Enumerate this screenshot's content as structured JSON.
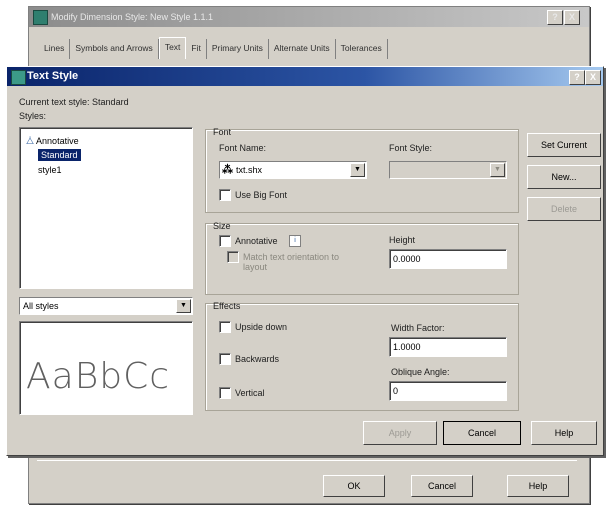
{
  "background_dialog": {
    "title": "Modify Dimension Style: New Style 1.1.1",
    "help_btn": "?",
    "close_btn": "X",
    "tabs": [
      "Lines",
      "Symbols and Arrows",
      "Text",
      "Fit",
      "Primary Units",
      "Alternate Units",
      "Tolerances"
    ],
    "ok_label": "OK",
    "cancel_label": "Cancel",
    "help_label": "Help"
  },
  "dialog": {
    "title": "Text Style",
    "help_btn": "?",
    "close_btn": "X",
    "current_style_label": "Current text style:",
    "current_style_value": "Standard",
    "styles_label": "Styles:",
    "styles": [
      "Annotative",
      "Standard",
      "style1"
    ],
    "styles_filter": "All styles",
    "preview_text": "AaBbCc",
    "font": {
      "group_label": "Font",
      "font_name_label": "Font Name:",
      "font_name_value": "txt.shx",
      "font_style_label": "Font Style:",
      "font_style_value": "",
      "big_font_label": "Use Big Font"
    },
    "size": {
      "group_label": "Size",
      "annotative_label": "Annotative",
      "annotative_info": "i",
      "match_orientation_label": "Match text orientation to layout",
      "height_label": "Height",
      "height_value": "0.0000"
    },
    "effects": {
      "group_label": "Effects",
      "upside_down_label": "Upside down",
      "backwards_label": "Backwards",
      "vertical_label": "Vertical",
      "width_factor_label": "Width Factor:",
      "width_factor_value": "1.0000",
      "oblique_angle_label": "Oblique Angle:",
      "oblique_angle_value": "0"
    },
    "buttons": {
      "set_current": "Set Current",
      "new": "New...",
      "delete": "Delete",
      "apply": "Apply",
      "cancel": "Cancel",
      "help": "Help"
    }
  }
}
